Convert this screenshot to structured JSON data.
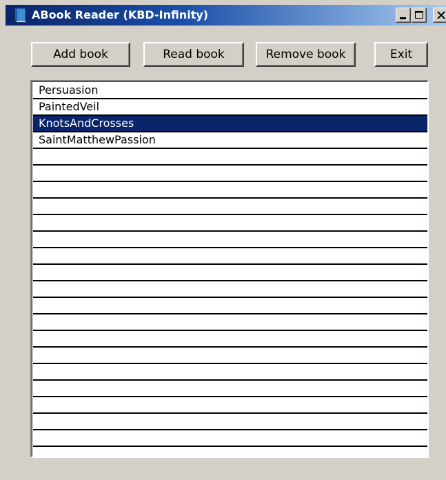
{
  "window": {
    "title": "ABook Reader (KBD-Infinity)",
    "icon": "book-icon",
    "controls": {
      "minimize": "minimize-icon",
      "maximize": "maximize-icon",
      "close": "close-icon"
    }
  },
  "toolbar": {
    "add_label": "Add book",
    "read_label": "Read book",
    "remove_label": "Remove book",
    "exit_label": "Exit"
  },
  "books": {
    "items": [
      {
        "label": "Persuasion"
      },
      {
        "label": "PaintedVeil"
      },
      {
        "label": "KnotsAndCrosses"
      },
      {
        "label": "SaintMatthewPassion"
      }
    ],
    "selected_index": 2
  },
  "colors": {
    "window_bg": "#d4d0c8",
    "selection_bg": "#0a246a",
    "selection_fg": "#ffffff",
    "title_bar": "#0a246a"
  }
}
